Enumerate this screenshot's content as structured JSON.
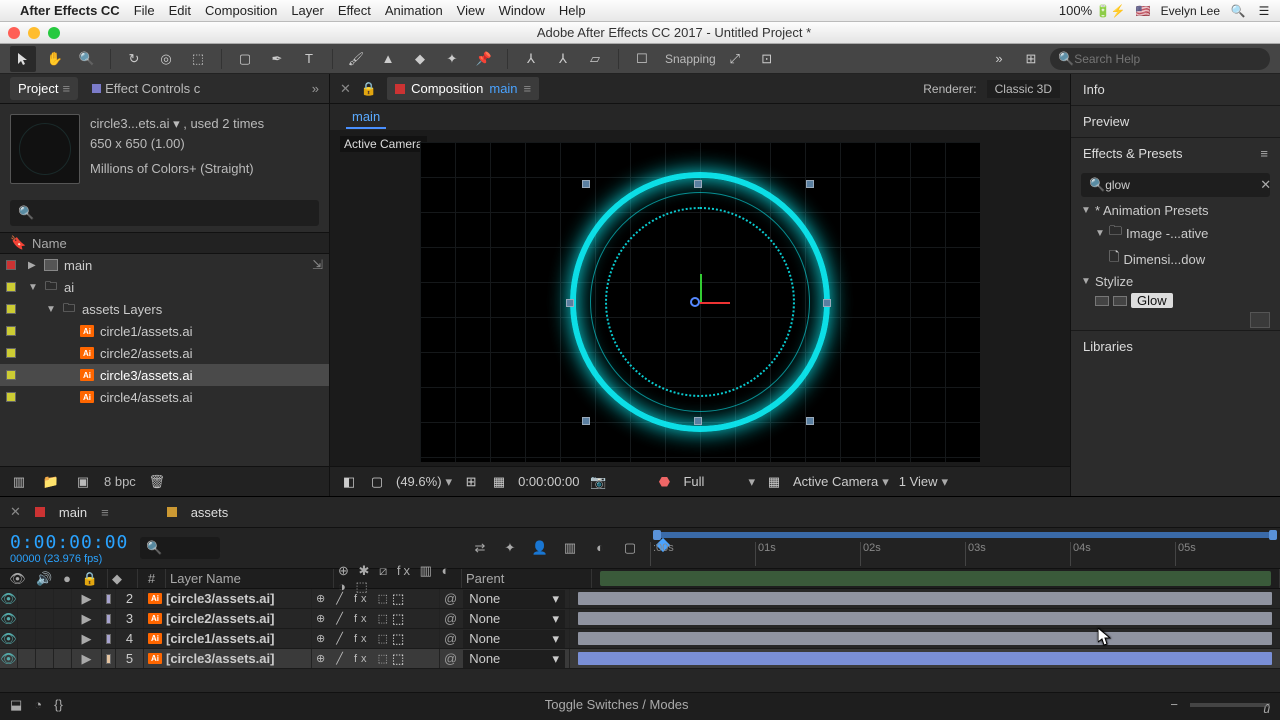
{
  "mac_menu": {
    "app": "After Effects CC",
    "items": [
      "File",
      "Edit",
      "Composition",
      "Layer",
      "Effect",
      "Animation",
      "View",
      "Window",
      "Help"
    ],
    "right": {
      "battery": "100% ",
      "user": "Evelyn Lee"
    }
  },
  "window": {
    "title": "Adobe After Effects CC 2017 - Untitled Project *"
  },
  "toolbar": {
    "snapping": "Snapping",
    "search_help_placeholder": "Search Help"
  },
  "project_panel": {
    "tabs": {
      "project": "Project",
      "effect_controls": "Effect Controls c"
    },
    "item_info": {
      "line1": "circle3...ets.ai ▾ , used 2 times",
      "line2": "650 x 650 (1.00)",
      "line3": "Millions of Colors+ (Straight)"
    },
    "name_header": "Name",
    "items": [
      {
        "type": "comp",
        "label": "main",
        "indent": 0,
        "expanded": false,
        "color": "#c33"
      },
      {
        "type": "folder",
        "label": "ai",
        "indent": 0,
        "expanded": true,
        "color": "#cc3"
      },
      {
        "type": "folder",
        "label": "assets Layers",
        "indent": 1,
        "expanded": true,
        "color": "#cc3"
      },
      {
        "type": "ai",
        "label": "circle1/assets.ai",
        "indent": 2,
        "color": "#cc3"
      },
      {
        "type": "ai",
        "label": "circle2/assets.ai",
        "indent": 2,
        "color": "#cc3"
      },
      {
        "type": "ai",
        "label": "circle3/assets.ai",
        "indent": 2,
        "color": "#cc3",
        "selected": true
      },
      {
        "type": "ai",
        "label": "circle4/assets.ai",
        "indent": 2,
        "color": "#cc3"
      }
    ],
    "bpc": "8 bpc"
  },
  "comp_panel": {
    "label_composition": "Composition",
    "name": "main",
    "subtab": "main",
    "renderer_label": "Renderer:",
    "renderer_value": "Classic 3D",
    "active_camera": "Active Camera"
  },
  "viewer_footer": {
    "zoom": "(49.6%)",
    "timecode": "0:00:00:00",
    "resolution": "Full",
    "camera": "Active Camera",
    "views": "1 View"
  },
  "right_panel": {
    "info": "Info",
    "preview": "Preview",
    "effects_presets": "Effects & Presets",
    "search_value": "glow",
    "tree": {
      "root": "* Animation Presets",
      "group": "Image -...ative",
      "item": "Dimensi...dow",
      "stylize": "Stylize",
      "glow": "Glow"
    },
    "libraries": "Libraries"
  },
  "timeline": {
    "tabs": {
      "main": "main",
      "assets": "assets"
    },
    "timecode": "0:00:00:00",
    "subline": "00000 (23.976 fps)",
    "ticks": [
      ":00s",
      "01s",
      "02s",
      "03s",
      "04s",
      "05s"
    ],
    "columns": {
      "av": "👁🔊●🔒",
      "hash": "#",
      "layer_name": "Layer Name",
      "switches": "⊕ ✱ ⧄ fx ▥ ◐ ◑ ⬚",
      "parent": "Parent"
    },
    "layers": [
      {
        "num": "2",
        "tag": "purple",
        "label": "[circle3/assets.ai]",
        "switches": "⊕   ╱ fx       ⬚",
        "parent": "None",
        "selected": false
      },
      {
        "num": "3",
        "tag": "purple",
        "label": "[circle2/assets.ai]",
        "switches": "⊕   ╱ fx       ⬚",
        "parent": "None",
        "selected": false
      },
      {
        "num": "4",
        "tag": "purple",
        "label": "[circle1/assets.ai]",
        "switches": "⊕   ╱ fx       ⬚",
        "parent": "None",
        "selected": false
      },
      {
        "num": "5",
        "tag": "peach",
        "label": "[circle3/assets.ai]",
        "switches": "⊕   ╱ fx       ⬚",
        "parent": "None",
        "selected": true
      }
    ],
    "footer": "Toggle Switches / Modes"
  }
}
